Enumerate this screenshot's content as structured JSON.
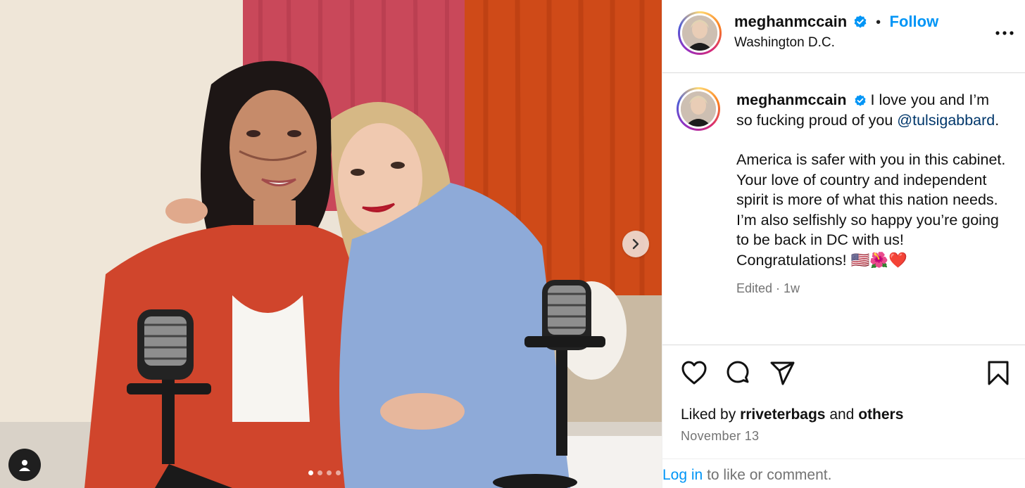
{
  "header": {
    "username": "meghanmccain",
    "bullet": "•",
    "follow_label": "Follow",
    "location": "Washington D.C."
  },
  "caption": {
    "username": "meghanmccain",
    "text_part1": "I love you and I’m so fucking proud of you",
    "mention": "@tulsigabbard",
    "mention_suffix": ".",
    "text_part2": "America is safer with you in this cabinet. Your love of country and independent spirit is more of what this nation needs. I’m also selfishly so happy you’re going to be back in DC with us! Congratulations! 🇺🇸🌺❤️",
    "meta": "Edited · 1w"
  },
  "likes": {
    "prefix": "Liked by",
    "user": "rriveterbags",
    "conj": "and",
    "others": "others"
  },
  "date": "November 13",
  "login": {
    "link": "Log in",
    "rest": "to like or comment."
  },
  "carousel": {
    "current": 1,
    "total": 4
  },
  "icons": {
    "verified": "verified-badge-icon",
    "more": "more-options-icon",
    "like": "heart-icon",
    "comment": "comment-icon",
    "share": "share-icon",
    "save": "bookmark-icon",
    "next": "chevron-right-icon",
    "tagged": "user-tag-icon"
  },
  "colors": {
    "accent": "#0095f6",
    "mention": "#00376b",
    "verified": "#0095f6",
    "secondary_text": "#737373"
  }
}
